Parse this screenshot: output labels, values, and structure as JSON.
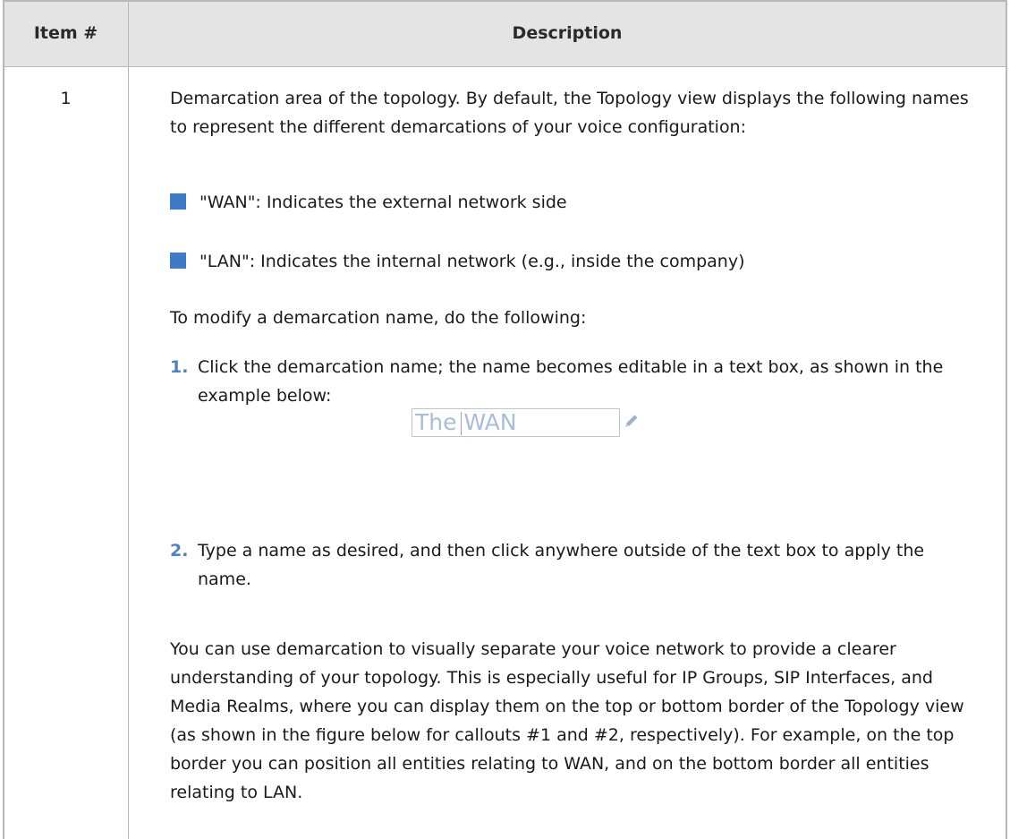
{
  "table": {
    "headers": {
      "item": "Item #",
      "description": "Description"
    },
    "row": {
      "item_number": "1",
      "intro": "Demarcation area of the topology. By default, the Topology view displays the following names to represent the different demarcations of your voice configuration:",
      "bullets": [
        "\"WAN\": Indicates the external network side",
        "\"LAN\": Indicates the internal network (e.g., inside the company)"
      ],
      "modify_intro": "To modify a demarcation name, do the following:",
      "steps": [
        {
          "number": "1.",
          "text": "Click the demarcation name; the name becomes editable in a text box, as shown in the example below:"
        },
        {
          "number": "2.",
          "text": "Type a name as desired, and then click anywhere outside of the text box to apply the name."
        }
      ],
      "example": {
        "value": "The WAN",
        "icon": "pencil-icon"
      },
      "closing": "You can use demarcation to visually separate your voice network to provide a clearer understanding of your topology. This is especially useful for IP Groups, SIP Interfaces, and Media Realms, where you can display them on the top or bottom border of the Topology view (as shown in the figure below for callouts #1 and #2, respectively). For example, on the top border you can position all entities relating to WAN, and on the bottom border all entities relating to LAN."
    },
    "colors": {
      "header_bg": "#e4e4e4",
      "border": "#b8b8b8",
      "bullet": "#3d7bc8",
      "step_number": "#4a82c4"
    }
  }
}
